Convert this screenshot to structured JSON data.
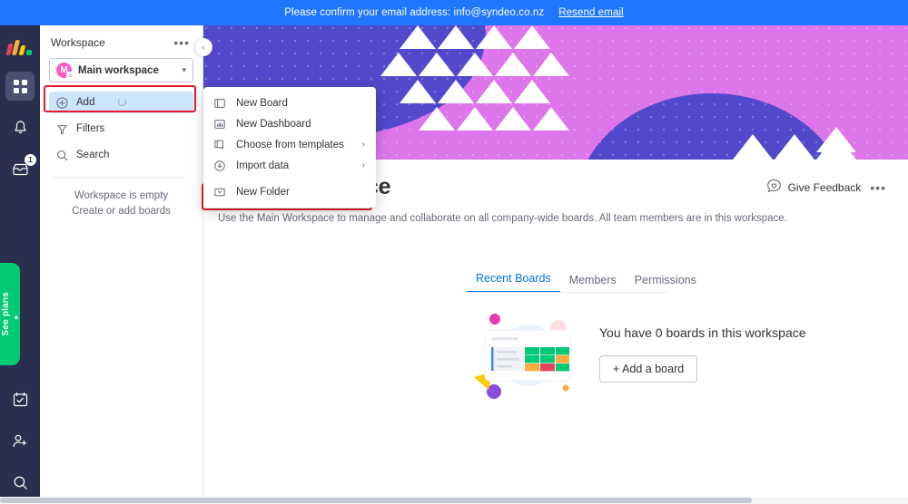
{
  "topbar": {
    "message": "Please confirm your email address: info@syndeo.co.nz",
    "resend_label": "Resend email"
  },
  "rail": {
    "logo_name": "monday-logo",
    "items": [
      {
        "name": "home-grid-icon",
        "label": "Home",
        "active": true
      },
      {
        "name": "bell-icon",
        "label": "Notifications",
        "active": false
      },
      {
        "name": "inbox-icon",
        "label": "Inbox",
        "active": false,
        "badge": "1"
      }
    ],
    "see_plans": {
      "label": "See plans",
      "icon": "rocket-icon",
      "color": "#00ca72"
    },
    "bottom_items": [
      {
        "name": "my-work-calendar-icon",
        "label": "My work"
      },
      {
        "name": "invite-member-icon",
        "label": "Invite members"
      },
      {
        "name": "search-icon",
        "label": "Search"
      }
    ]
  },
  "panel": {
    "title": "Workspace",
    "more_label": "•••",
    "workspace_selector": {
      "avatar_letter": "M",
      "avatar_color": "#ff5ac4",
      "name": "Main workspace",
      "chevron": "⌄"
    },
    "nav": [
      {
        "name": "add",
        "label": "Add",
        "icon": "plus-circle-icon",
        "selected": true,
        "loading": true
      },
      {
        "name": "filters",
        "label": "Filters",
        "icon": "funnel-icon",
        "selected": false
      },
      {
        "name": "search",
        "label": "Search",
        "icon": "search-icon",
        "selected": false
      }
    ],
    "empty_line1": "Workspace is empty",
    "empty_line2": "Create or add boards",
    "collapse_icon": "‹"
  },
  "menu": {
    "items": [
      {
        "label": "New Board",
        "icon": "board-icon",
        "chevron": ""
      },
      {
        "label": "New Dashboard",
        "icon": "dashboard-icon",
        "chevron": ""
      },
      {
        "label": "Choose from templates",
        "icon": "template-icon",
        "chevron": "›"
      },
      {
        "label": "Import data",
        "icon": "import-icon",
        "chevron": "›"
      },
      {
        "label": "New Folder",
        "icon": "folder-icon",
        "chevron": ""
      }
    ]
  },
  "main": {
    "title": "Main workspace",
    "description": "Use the Main Workspace to manage and collaborate on all company-wide boards. All team members are in this workspace.",
    "feedback_label": "Give Feedback",
    "feedback_icon": "heart-speech-icon",
    "more_label": "•••",
    "expand_icon": "›",
    "tabs": [
      {
        "label": "Recent Boards",
        "active": true
      },
      {
        "label": "Members",
        "active": false
      },
      {
        "label": "Permissions",
        "active": false
      }
    ],
    "empty_state": {
      "title": "You have 0 boards in this workspace",
      "button_label": "+ Add a board",
      "illustration_name": "empty-boards-illustration"
    }
  },
  "annotations": {
    "highlight_color": "#e8192c",
    "boxes": [
      "add-nav-item",
      "new-folder-menu-item"
    ]
  },
  "colors": {
    "topbar_blue": "#1f76ff",
    "rail_dark": "#292f4c",
    "hero_pink": "#dd75eb",
    "hero_purple": "#5148cc",
    "accent_blue": "#0073ea",
    "selected_blue": "#cce5ff"
  }
}
